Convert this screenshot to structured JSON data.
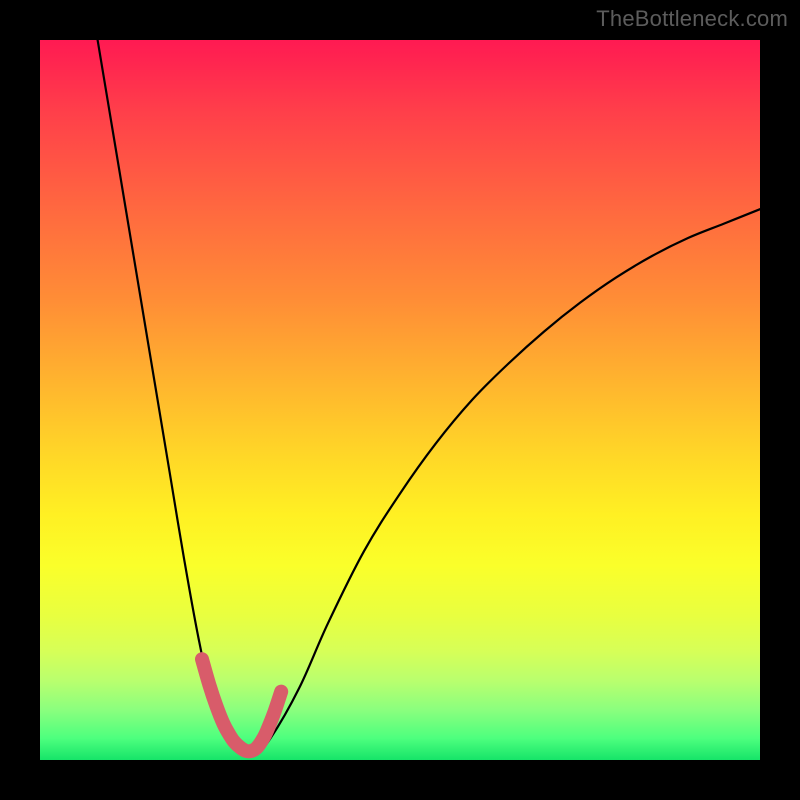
{
  "watermark": "TheBottleneck.com",
  "chart_data": {
    "type": "line",
    "title": "",
    "xlabel": "",
    "ylabel": "",
    "xlim": [
      0,
      100
    ],
    "ylim": [
      0,
      100
    ],
    "series": [
      {
        "name": "bottleneck-curve",
        "x": [
          8,
          10,
          12,
          14,
          16,
          18,
          20,
          22,
          24,
          26,
          28,
          30,
          32,
          36,
          40,
          45,
          50,
          55,
          60,
          65,
          70,
          75,
          80,
          85,
          90,
          95,
          100
        ],
        "values": [
          100,
          88,
          76,
          64,
          52,
          40,
          28,
          17,
          8,
          3,
          1,
          1,
          3,
          10,
          19,
          29,
          37,
          44,
          50,
          55,
          59.5,
          63.5,
          67,
          70,
          72.5,
          74.5,
          76.5
        ]
      }
    ],
    "highlight": {
      "name": "optimal-range",
      "x": [
        22.5,
        23.5,
        24.5,
        25.5,
        26.5,
        27.0,
        27.5,
        28.0,
        28.5,
        29.0,
        29.5,
        30.0,
        30.5,
        31.0,
        31.5,
        32.5,
        33.5
      ],
      "values": [
        14.0,
        10.5,
        7.5,
        5.0,
        3.2,
        2.5,
        2.0,
        1.6,
        1.3,
        1.2,
        1.3,
        1.6,
        2.2,
        3.0,
        4.0,
        6.5,
        9.5
      ]
    },
    "gradient_stops": [
      {
        "pos": 0.0,
        "color": "#ff1a52"
      },
      {
        "pos": 0.24,
        "color": "#ff6a3f"
      },
      {
        "pos": 0.48,
        "color": "#ffb62e"
      },
      {
        "pos": 0.66,
        "color": "#fff023"
      },
      {
        "pos": 0.85,
        "color": "#d6ff58"
      },
      {
        "pos": 1.0,
        "color": "#16e469"
      }
    ]
  }
}
